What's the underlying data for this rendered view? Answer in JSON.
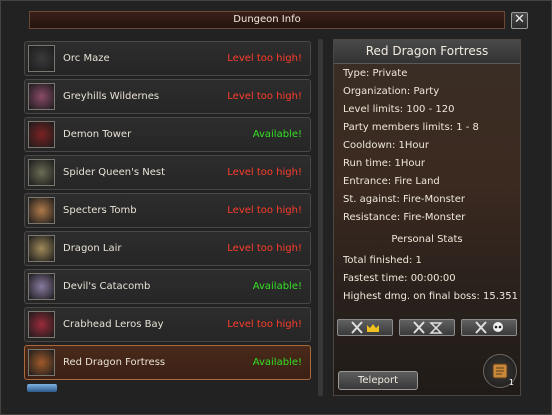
{
  "window": {
    "title": "Dungeon Info",
    "close_symbol": "✕"
  },
  "dungeons": [
    {
      "name": "Orc Maze",
      "status": "Level too high!",
      "available": false,
      "thumb_color": "#3a3a3a"
    },
    {
      "name": "Greyhills Wildernes",
      "status": "Level too high!",
      "available": false,
      "thumb_color": "#8a4a6a"
    },
    {
      "name": "Demon Tower",
      "status": "Available!",
      "available": true,
      "thumb_color": "#7a2222"
    },
    {
      "name": "Spider Queen's Nest",
      "status": "Level too high!",
      "available": false,
      "thumb_color": "#6b6b55"
    },
    {
      "name": "Specters Tomb",
      "status": "Level too high!",
      "available": false,
      "thumb_color": "#b07a4a"
    },
    {
      "name": "Dragon Lair",
      "status": "Level too high!",
      "available": false,
      "thumb_color": "#a08a5a"
    },
    {
      "name": "Devil's Catacomb",
      "status": "Available!",
      "available": true,
      "thumb_color": "#8a7aa0"
    },
    {
      "name": "Crabhead Leros Bay",
      "status": "Level too high!",
      "available": false,
      "thumb_color": "#9a2a3a"
    },
    {
      "name": "Red Dragon Fortress",
      "status": "Available!",
      "available": true,
      "thumb_color": "#a05a2a",
      "selected": true
    }
  ],
  "detail": {
    "title": "Red Dragon Fortress",
    "lines": [
      "Type: Private",
      "Organization: Party",
      "Level limits: 100 - 120",
      "Party members limits: 1 - 8",
      "Cooldown: 1Hour",
      "Run time: 1Hour",
      "Entrance: Fire Land",
      "St. against: Fire-Monster",
      "Resistance: Fire-Monster"
    ],
    "personal_stats_label": "Personal Stats",
    "stats": [
      "Total finished: 1",
      "Fastest time: 00:00:00",
      "Highest dmg. on final boss: 15.351"
    ]
  },
  "actions": {
    "teleport_label": "Teleport",
    "ranking_buttons": [
      "crown-rank",
      "time-rank",
      "damage-rank"
    ],
    "scroll_count": "1"
  },
  "colors": {
    "unavailable": "#ff3c2c",
    "available": "#34e024",
    "selected_border": "#a9693a"
  }
}
